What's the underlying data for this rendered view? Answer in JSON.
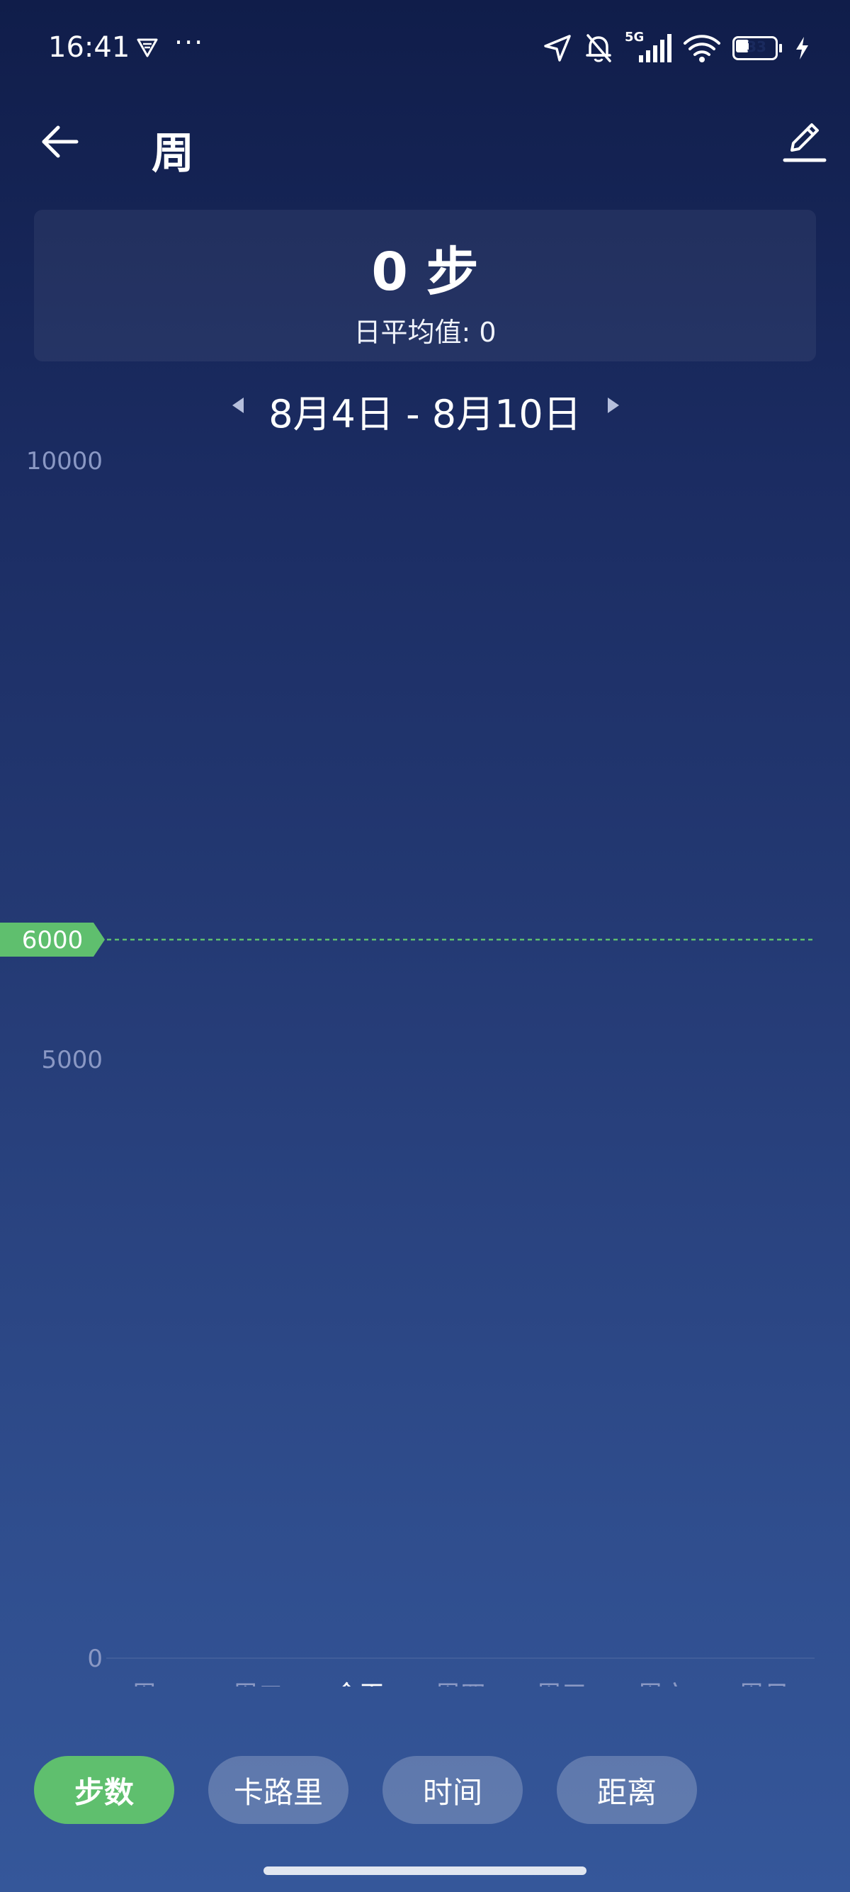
{
  "status_bar": {
    "time": "16:41",
    "more": "···",
    "network": "5G",
    "battery_level": "33",
    "battery_fraction": 0.33,
    "icons": [
      "vpn-icon",
      "location-icon",
      "bell-muted-icon",
      "signal-icon",
      "wifi-icon",
      "battery-icon",
      "charging-icon"
    ]
  },
  "header": {
    "title": "周",
    "back_icon": "arrow-left-icon",
    "edit_icon": "pencil-icon"
  },
  "summary": {
    "steps_value": "0",
    "steps_unit": "步",
    "average_label": "日平均值:",
    "average_value": "0"
  },
  "date_range": {
    "label": "8月4日 - 8月10日"
  },
  "chart_data": {
    "type": "bar",
    "categories": [
      "周一",
      "周二",
      "今天",
      "周四",
      "周五",
      "周六",
      "周日"
    ],
    "highlighted_category": "今天",
    "values": [
      0,
      0,
      0,
      0,
      0,
      0,
      0
    ],
    "y_ticks": [
      "10000",
      "5000",
      "0"
    ],
    "ylim": [
      0,
      10000
    ],
    "goal": {
      "value": 6000,
      "label": "6000",
      "color": "#5fbf6e"
    }
  },
  "tabs": [
    {
      "label": "步数",
      "active": true
    },
    {
      "label": "卡路里",
      "active": false
    },
    {
      "label": "时间",
      "active": false
    },
    {
      "label": "距离",
      "active": false
    }
  ],
  "colors": {
    "accent": "#5fbf6e",
    "axis_text": "#8a98c4",
    "background_top": "#101d4a",
    "background_bottom": "#35579a"
  }
}
